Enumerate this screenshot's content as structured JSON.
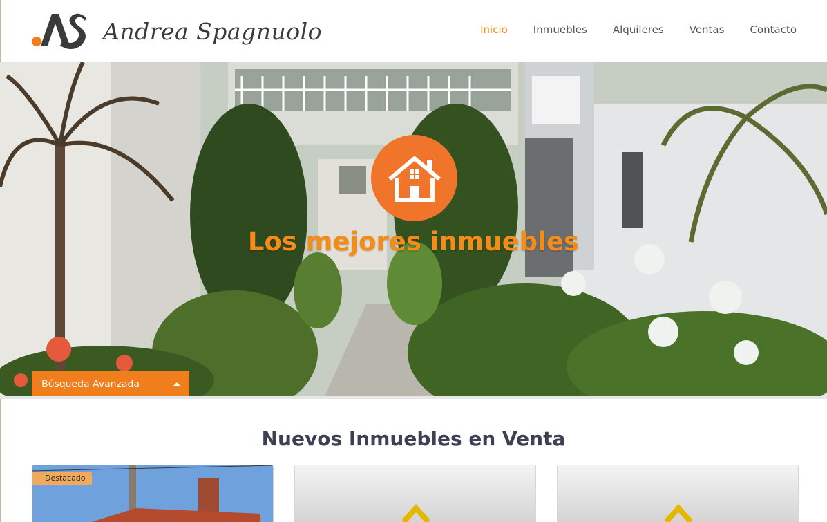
{
  "header": {
    "logo_text": "Andrea Spagnuolo",
    "nav": [
      {
        "label": "Inicio",
        "active": true
      },
      {
        "label": "Inmuebles",
        "active": false
      },
      {
        "label": "Alquileres",
        "active": false
      },
      {
        "label": "Ventas",
        "active": false
      },
      {
        "label": "Contacto",
        "active": false
      }
    ]
  },
  "hero": {
    "icon": "house-icon",
    "title": "Los mejores inmuebles",
    "search_toggle_label": "Búsqueda Avanzada"
  },
  "section": {
    "title": "Nuevos Inmuebles en Venta"
  },
  "cards": [
    {
      "badge": "Destacado",
      "image": "property-photo"
    },
    {
      "badge": "",
      "image": "placeholder-house-icon"
    },
    {
      "badge": "",
      "image": "placeholder-house-icon"
    }
  ],
  "colors": {
    "accent": "#f07e1d",
    "nav_active": "#f08a1c",
    "hero_icon_bg": "#f0742a",
    "title_text": "#3b4150",
    "placeholder_icon": "#e5b800"
  }
}
